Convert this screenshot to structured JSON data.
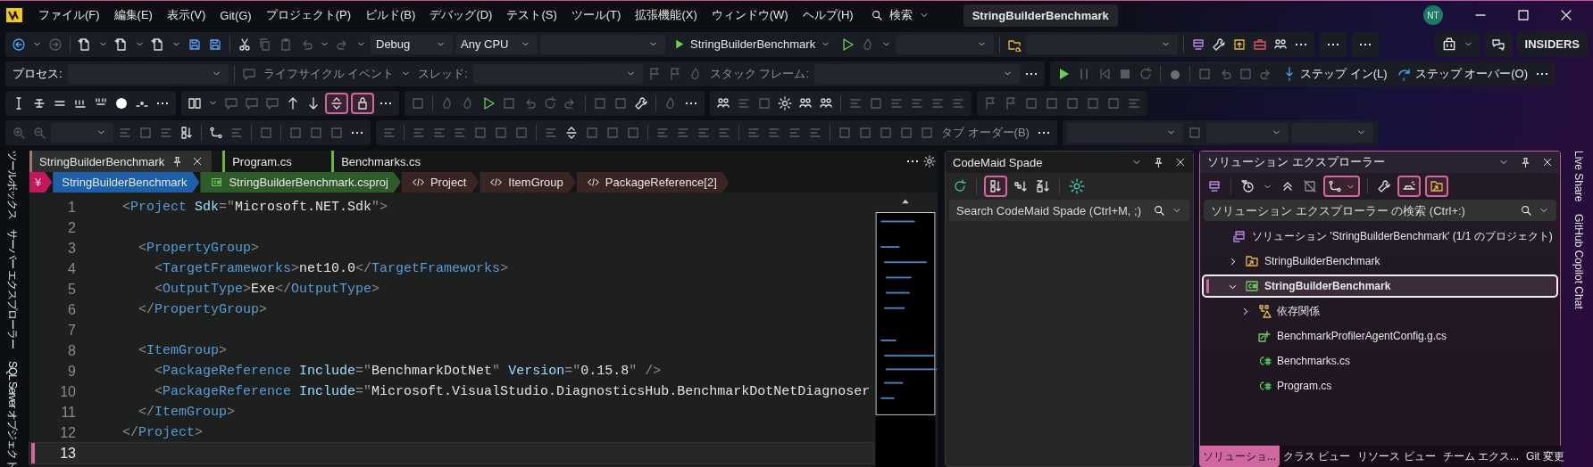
{
  "menu_bar": {
    "items": [
      "ファイル(F)",
      "編集(E)",
      "表示(V)",
      "Git(G)",
      "プロジェクト(P)",
      "ビルド(B)",
      "デバッグ(D)",
      "テスト(S)",
      "ツール(T)",
      "拡張機能(X)",
      "ウィンドウ(W)",
      "ヘルプ(H)"
    ],
    "search": "検索",
    "solution_name": "StringBuilderBenchmark",
    "user_initials": "NT"
  },
  "main_toolbar": {
    "configuration": "Debug",
    "platform": "Any CPU",
    "start_target": "StringBuilderBenchmark",
    "badge": "INSIDERS"
  },
  "debug_toolbar": {
    "process_label": "プロセス:",
    "lifecycle": "ライフサイクル イベント",
    "thread_label": "スレッド:",
    "stack_label": "スタック フレーム:",
    "step_into": "ステップ イン(L)",
    "step_over": "ステップ オーバー(O)"
  },
  "text_toolbar": {
    "toggles": [
      {
        "checked": true
      },
      {
        "checked": true
      }
    ]
  },
  "layout_toolbar": {
    "tab_order": "タブ オーダー(B)"
  },
  "left_tool_tabs": [
    "ツールボックス",
    "サーバー エクスプローラー",
    "SQL Server オブジェクト"
  ],
  "editor": {
    "tabs": [
      {
        "label": "StringBuilderBenchmark",
        "selected": true,
        "color": "#a8766c"
      },
      {
        "label": "Program.cs",
        "selected": false,
        "color": "#6fb833"
      },
      {
        "label": "Benchmarks.cs",
        "selected": false,
        "color": "#6fb833"
      }
    ],
    "breadcrumb": [
      {
        "label": "¥",
        "kind": "root"
      },
      {
        "label": "StringBuilderBenchmark",
        "kind": "project"
      },
      {
        "label": "StringBuilderBenchmark.csproj",
        "kind": "file"
      },
      {
        "label": "Project",
        "kind": "node"
      },
      {
        "label": "ItemGroup",
        "kind": "node"
      },
      {
        "label": "PackageReference[2]",
        "kind": "node"
      }
    ],
    "lines": [
      {
        "number": "1",
        "tokens": [
          {
            "kind": "delim",
            "text": "<"
          },
          {
            "kind": "tag",
            "text": "Project"
          },
          {
            "kind": "attr",
            "text": " Sdk"
          },
          {
            "kind": "delim",
            "text": "=\""
          },
          {
            "kind": "value",
            "text": "Microsoft.NET.Sdk"
          },
          {
            "kind": "delim",
            "text": "\">"
          }
        ]
      },
      {
        "number": "2"
      },
      {
        "number": "3",
        "tokens": [
          {
            "kind": "delim",
            "text": "  <"
          },
          {
            "kind": "tag",
            "text": "PropertyGroup"
          },
          {
            "kind": "delim",
            "text": ">"
          }
        ]
      },
      {
        "number": "4",
        "tokens": [
          {
            "kind": "delim",
            "text": "    <"
          },
          {
            "kind": "tag",
            "text": "TargetFrameworks"
          },
          {
            "kind": "delim",
            "text": ">"
          },
          {
            "kind": "value",
            "text": "net10.0"
          },
          {
            "kind": "delim",
            "text": "</"
          },
          {
            "kind": "tag",
            "text": "TargetFrameworks"
          },
          {
            "kind": "delim",
            "text": ">"
          }
        ]
      },
      {
        "number": "5",
        "tokens": [
          {
            "kind": "delim",
            "text": "    <"
          },
          {
            "kind": "tag",
            "text": "OutputType"
          },
          {
            "kind": "delim",
            "text": ">"
          },
          {
            "kind": "value",
            "text": "Exe"
          },
          {
            "kind": "delim",
            "text": "</"
          },
          {
            "kind": "tag",
            "text": "OutputType"
          },
          {
            "kind": "delim",
            "text": ">"
          }
        ]
      },
      {
        "number": "6",
        "tokens": [
          {
            "kind": "delim",
            "text": "  </"
          },
          {
            "kind": "tag",
            "text": "PropertyGroup"
          },
          {
            "kind": "delim",
            "text": ">"
          }
        ]
      },
      {
        "number": "7"
      },
      {
        "number": "8",
        "tokens": [
          {
            "kind": "delim",
            "text": "  <"
          },
          {
            "kind": "tag",
            "text": "ItemGroup"
          },
          {
            "kind": "delim",
            "text": ">"
          }
        ]
      },
      {
        "number": "9",
        "tokens": [
          {
            "kind": "delim",
            "text": "    <"
          },
          {
            "kind": "tag",
            "text": "PackageReference"
          },
          {
            "kind": "attr",
            "text": " Include"
          },
          {
            "kind": "delim",
            "text": "=\""
          },
          {
            "kind": "value",
            "text": "BenchmarkDotNet"
          },
          {
            "kind": "delim",
            "text": "\""
          },
          {
            "kind": "attr",
            "text": " Version"
          },
          {
            "kind": "delim",
            "text": "=\""
          },
          {
            "kind": "value",
            "text": "0.15.8"
          },
          {
            "kind": "delim",
            "text": "\" />"
          }
        ]
      },
      {
        "number": "10",
        "tokens": [
          {
            "kind": "delim",
            "text": "    <"
          },
          {
            "kind": "tag",
            "text": "PackageReference"
          },
          {
            "kind": "attr",
            "text": " Include"
          },
          {
            "kind": "delim",
            "text": "=\""
          },
          {
            "kind": "value",
            "text": "Microsoft.VisualStudio.DiagnosticsHub.BenchmarkDotNetDiagnoser"
          }
        ]
      },
      {
        "number": "11",
        "tokens": [
          {
            "kind": "delim",
            "text": "  </"
          },
          {
            "kind": "tag",
            "text": "ItemGroup"
          },
          {
            "kind": "delim",
            "text": ">"
          }
        ]
      },
      {
        "number": "12",
        "tokens": [
          {
            "kind": "delim",
            "text": "</"
          },
          {
            "kind": "tag",
            "text": "Project"
          },
          {
            "kind": "delim",
            "text": ">"
          }
        ]
      },
      {
        "number": "13",
        "current": true
      }
    ]
  },
  "codemaid": {
    "title": "CodeMaid Spade",
    "toggles": [
      {
        "checked": true
      }
    ],
    "search_placeholder": "Search CodeMaid Spade (Ctrl+M, ;)"
  },
  "solution_explorer": {
    "title": "ソリューション エクスプローラー",
    "toggles": [
      {
        "checked": true
      },
      {
        "checked": true
      },
      {
        "checked": true
      }
    ],
    "search_placeholder": "ソリューション エクスプローラー の検索 (Ctrl+:)",
    "tree": [
      {
        "label": "ソリューション 'StringBuilderBenchmark' (1/1 のプロジェクト)",
        "kind": "solution",
        "selected": false,
        "children": [
          {
            "label": "StringBuilderBenchmark",
            "kind": "folder",
            "selected": false,
            "expanded": false
          },
          {
            "label": "StringBuilderBenchmark",
            "kind": "project",
            "selected": true,
            "expanded": true,
            "children": [
              {
                "label": "依存関係",
                "kind": "dependencies",
                "selected": false,
                "expanded": false
              },
              {
                "label": "BenchmarkProfilerAgentConfig.g.cs",
                "kind": "generated",
                "selected": false
              },
              {
                "label": "Benchmarks.cs",
                "kind": "cs",
                "selected": false
              },
              {
                "label": "Program.cs",
                "kind": "cs",
                "selected": false
              }
            ]
          }
        ]
      }
    ],
    "bottom_tabs": [
      {
        "label": "ソリューショ...",
        "selected": true
      },
      {
        "label": "クラス ビュー",
        "selected": false
      },
      {
        "label": "リソース ビュー",
        "selected": false
      },
      {
        "label": "チーム エクス...",
        "selected": false
      },
      {
        "label": "Git 変更",
        "selected": false
      }
    ]
  },
  "right_tool_tabs": [
    "Live Share",
    "GitHub Copilot Chat"
  ]
}
